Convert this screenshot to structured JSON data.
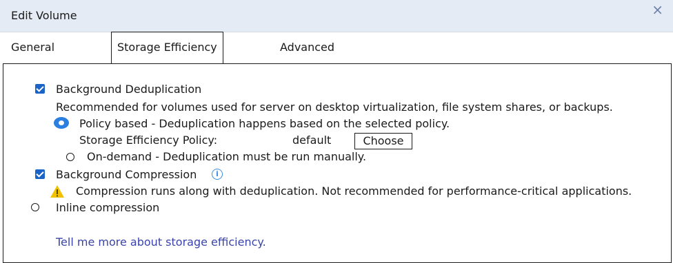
{
  "dialog": {
    "title": "Edit Volume",
    "close_icon": "×"
  },
  "tabs": [
    {
      "label": "General",
      "active": false
    },
    {
      "label": "Storage Efficiency",
      "active": true
    },
    {
      "label": "Advanced",
      "active": false
    }
  ],
  "dedup": {
    "label": "Background Deduplication",
    "checked": true,
    "description": "Recommended for volumes used for server on desktop virtualization, file system shares, or backups.",
    "policy_option": {
      "label": "Policy based - Deduplication happens based on the selected policy.",
      "selected": true
    },
    "policy_label": "Storage Efficiency Policy:",
    "policy_value": "default",
    "choose_button": "Choose",
    "ondemand_option": {
      "label": "On-demand - Deduplication must be run manually.",
      "selected": false
    }
  },
  "compression": {
    "label": "Background Compression",
    "checked": true,
    "info_icon": "info-icon",
    "warning_icon": "warning-icon",
    "warning_text": "Compression runs along with deduplication. Not recommended for performance-critical applications.",
    "inline_label": "Inline compression",
    "inline_selected": false
  },
  "help_link": "Tell me more about storage efficiency.",
  "colors": {
    "title_bar": "#e4ebf5",
    "checkbox": "#1b63c6",
    "link": "#3a44a8",
    "warning": "#f2c200"
  }
}
